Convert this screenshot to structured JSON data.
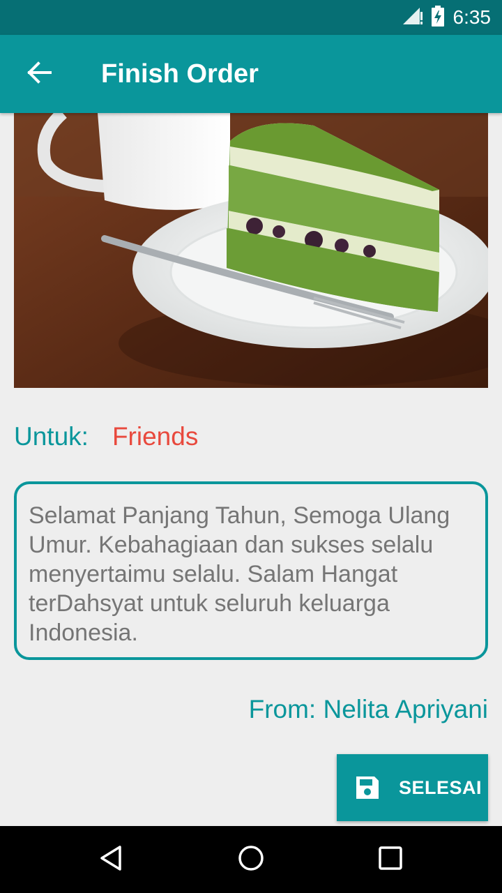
{
  "status_bar": {
    "time": "6:35",
    "icons": [
      "signal-icon",
      "battery-icon"
    ]
  },
  "app_bar": {
    "title": "Finish Order",
    "back_icon": "arrow-back-icon"
  },
  "hero_image": {
    "description": "green-tea-cake-photo"
  },
  "recipient": {
    "label": "Untuk:",
    "value": "Friends"
  },
  "message": {
    "text": "Selamat Panjang Tahun, Semoga Ulang Umur. Kebahagiaan dan sukses selalu menyertaimu selalu. Salam Hangat terDahsyat untuk seluruh keluarga Indonesia."
  },
  "sender": {
    "text": "From: Nelita Apriyani"
  },
  "action_button": {
    "label": "SELESAI",
    "icon": "save-icon"
  },
  "nav_bar": {
    "icons": [
      "nav-back-icon",
      "nav-home-icon",
      "nav-recents-icon"
    ]
  },
  "colors": {
    "primary": "#0a969b",
    "primary_dark": "#066f74",
    "accent_red": "#e8493d",
    "background": "#eeeeee",
    "message_text": "#757575"
  }
}
